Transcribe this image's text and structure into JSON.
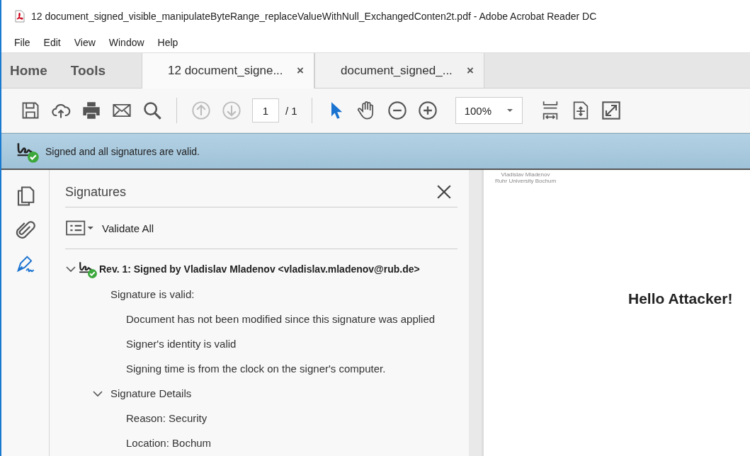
{
  "window": {
    "title": "12 document_signed_visible_manipulateByteRange_replaceValueWithNull_ExchangedConten2t.pdf - Adobe Acrobat Reader DC"
  },
  "menu": [
    "File",
    "Edit",
    "View",
    "Window",
    "Help"
  ],
  "nav": [
    "Home",
    "Tools"
  ],
  "tabs": [
    {
      "label": "12 document_signe...",
      "close": "×",
      "selected": true
    },
    {
      "label": "document_signed_...",
      "close": "×",
      "selected": false
    }
  ],
  "toolbar": {
    "page": "1",
    "page_total": "/ 1",
    "zoom": "100%"
  },
  "banner": {
    "message": "Signed and all signatures are valid."
  },
  "signatures_panel": {
    "title": "Signatures",
    "validate_label": "Validate All",
    "tree": [
      {
        "kind": "signature",
        "label": "Rev. 1: Signed by Vladislav Mladenov <vladislav.mladenov@rub.de>",
        "expanded": true,
        "children": [
          {
            "label": "Signature is valid:",
            "children": [
              {
                "label": "Document has not been modified since this signature was applied"
              },
              {
                "label": "Signer's identity is valid"
              },
              {
                "label": "Signing time is from the clock on the signer's computer."
              }
            ]
          },
          {
            "label": "Signature Details",
            "expanded": true,
            "children": [
              {
                "label": "Reason: Security"
              },
              {
                "label": "Location: Bochum"
              }
            ]
          }
        ]
      }
    ]
  },
  "document": {
    "header": [
      "Vladislav Mladenov",
      "Ruhr University Bochum"
    ],
    "body": "Hello Attacker!"
  }
}
